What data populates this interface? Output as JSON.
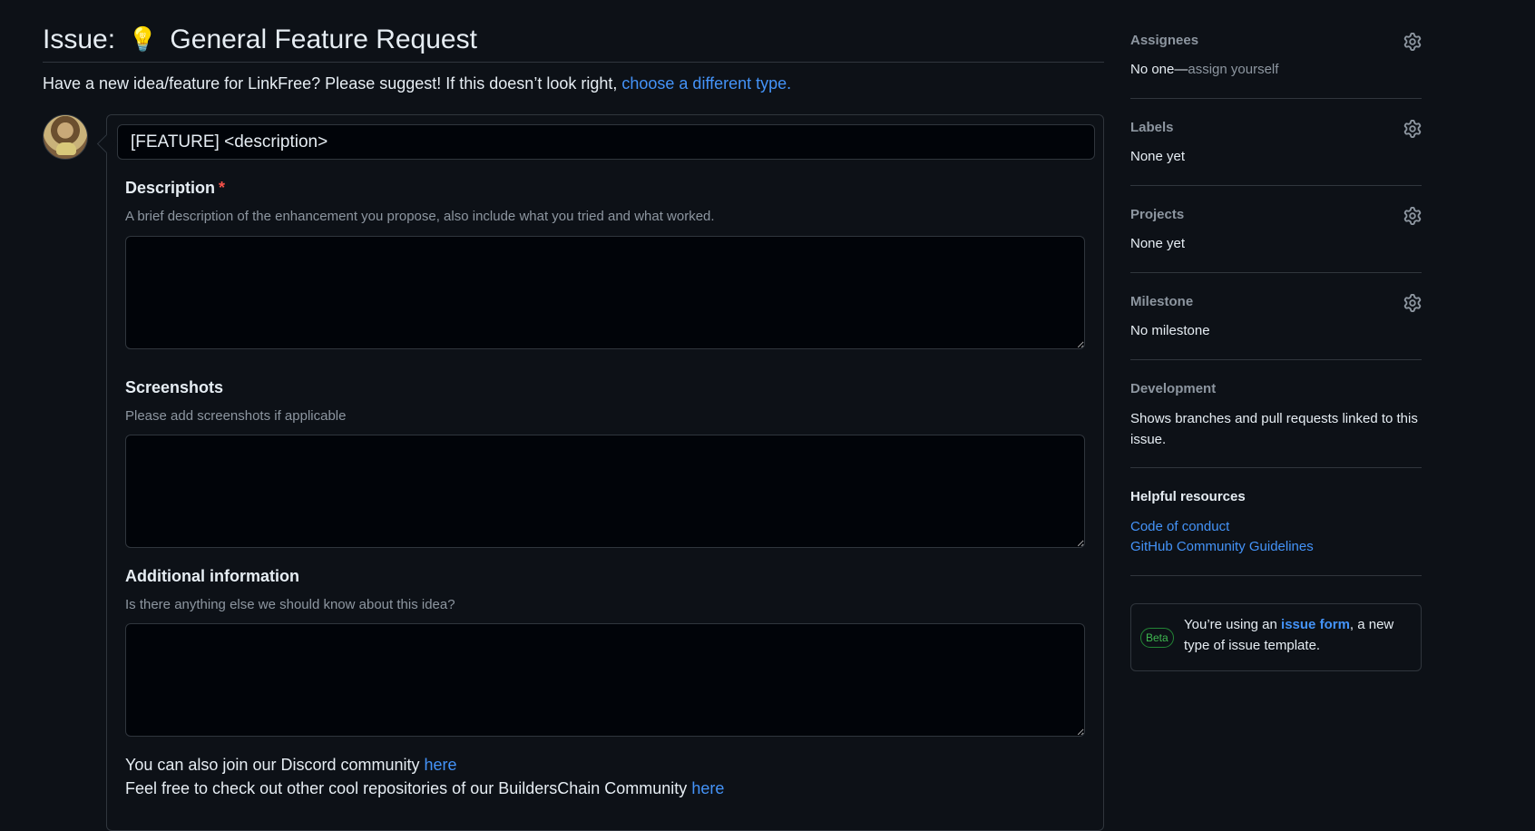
{
  "issue": {
    "prefix": "Issue:",
    "emoji": "💡",
    "template_name": "General Feature Request",
    "intro_text": "Have a new idea/feature for LinkFree? Please suggest! If this doesn’t look right,",
    "intro_link": "choose a different type.",
    "title_value": "[FEATURE] <description>"
  },
  "fields": [
    {
      "label": "Description",
      "required_mark": "*",
      "description": "A brief description of the enhancement you propose, also include what you tried and what worked.",
      "value": ""
    },
    {
      "label": "Screenshots",
      "description": "Please add screenshots if applicable",
      "value": ""
    },
    {
      "label": "Additional information",
      "description": "Is there anything else we should know about this idea?",
      "value": ""
    }
  ],
  "footer": {
    "discord_text": "You can also join our Discord community",
    "discord_link": "here",
    "repos_text": "Feel free to check out other cool repositories of our BuildersChain Community",
    "repos_link": "here"
  },
  "sidebar": {
    "assignees": {
      "heading": "Assignees",
      "value_main": "No one—",
      "value_link": "assign yourself"
    },
    "labels": {
      "heading": "Labels",
      "value": "None yet"
    },
    "projects": {
      "heading": "Projects",
      "value": "None yet"
    },
    "milestone": {
      "heading": "Milestone",
      "value": "No milestone"
    },
    "development": {
      "heading": "Development",
      "value": "Shows branches and pull requests linked to this issue."
    },
    "helpful": {
      "heading": "Helpful resources",
      "links": [
        "Code of conduct",
        "GitHub Community Guidelines"
      ]
    },
    "beta": {
      "badge": "Beta",
      "text_before": "You’re using an",
      "link": "issue form",
      "text_after": ", a new type of issue template."
    }
  },
  "colors": {
    "background": "#0d1117",
    "link": "#4493f8",
    "border": "#30363d",
    "muted": "#8d96a0",
    "required": "#f85149",
    "beta_green": "#3fb950"
  },
  "icons": [
    "gear-icon",
    "lightbulb-icon"
  ]
}
